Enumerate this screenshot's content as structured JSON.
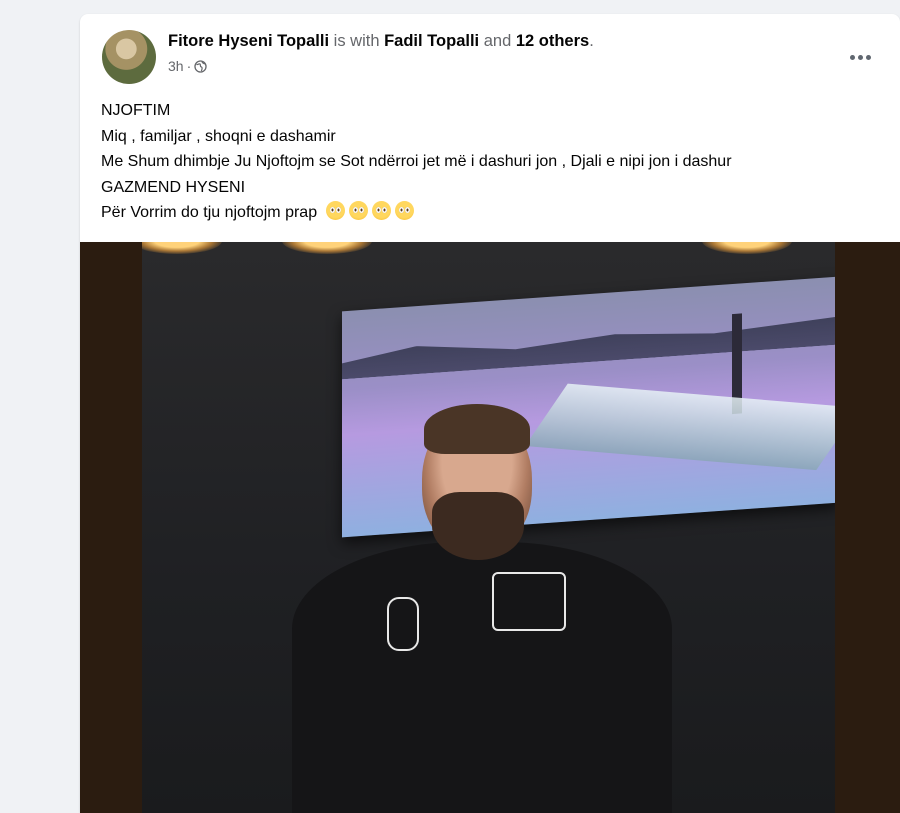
{
  "post": {
    "author": "Fitore Hyseni Topalli",
    "with_text": "is with",
    "tagged": "Fadil Topalli",
    "and_text": "and",
    "others": "12 others",
    "period": ".",
    "time": "3h",
    "separator": "·",
    "privacy_icon": "globe-icon",
    "more_icon": "more-horizontal-icon",
    "text_lines": [
      "NJOFTIM",
      "Miq , familjar , shoqni e dashamir",
      "Me Shum dhimbje Ju Njoftojm se Sot ndërroi jet më i dashuri jon , Djali e nipi jon i dashur",
      "GAZMEND HYSENI",
      "Për Vorrim do tju njoftojm prap"
    ],
    "emoji_name": "pleading-face-emoji",
    "emoji_count": 4
  },
  "colors": {
    "page_bg": "#f0f2f5",
    "card_bg": "#ffffff",
    "primary_text": "#050505",
    "secondary_text": "#65676b"
  }
}
